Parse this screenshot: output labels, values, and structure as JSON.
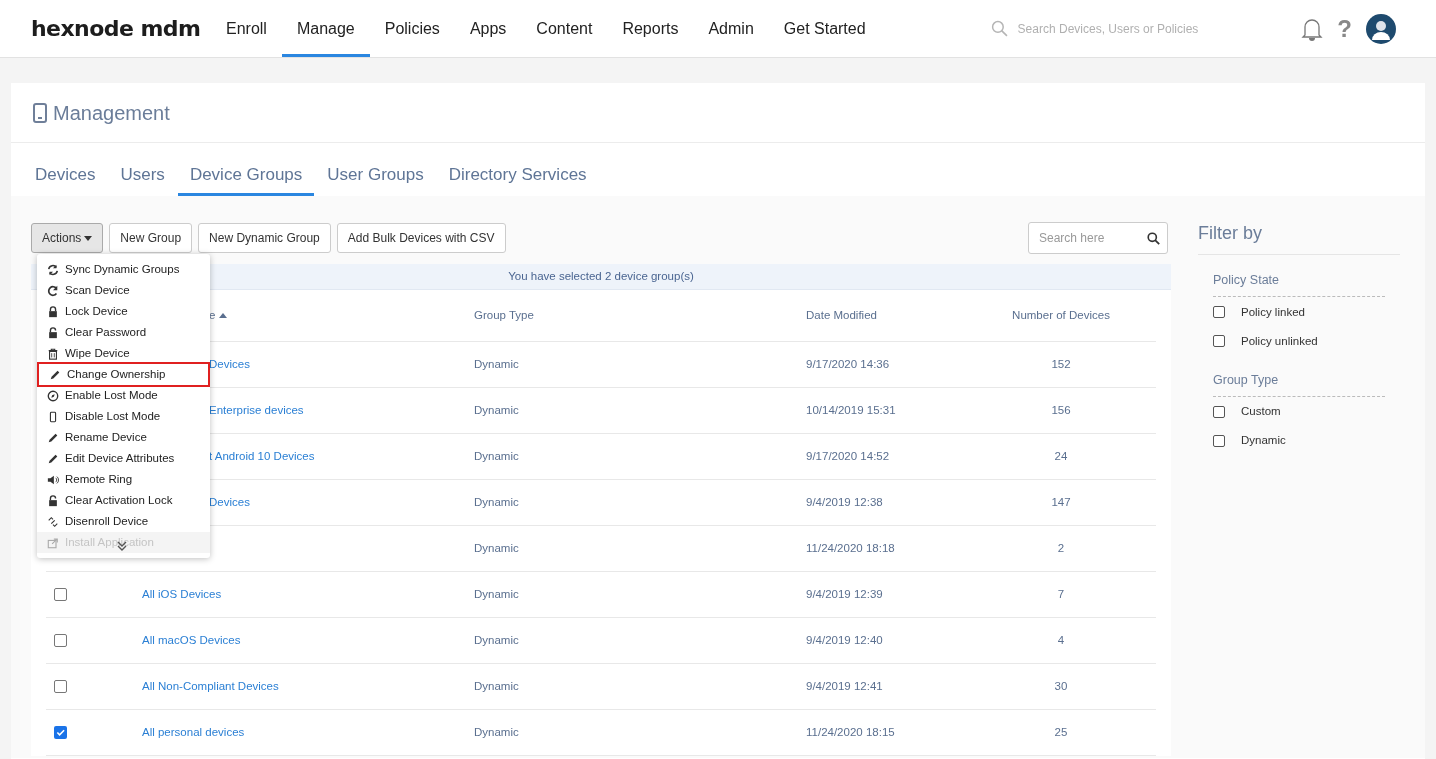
{
  "brand": "hexnode mdm",
  "nav": [
    {
      "label": "Enroll",
      "selected": false
    },
    {
      "label": "Manage",
      "selected": true
    },
    {
      "label": "Policies",
      "selected": false
    },
    {
      "label": "Apps",
      "selected": false
    },
    {
      "label": "Content",
      "selected": false
    },
    {
      "label": "Reports",
      "selected": false
    },
    {
      "label": "Admin",
      "selected": false
    },
    {
      "label": "Get Started",
      "selected": false
    }
  ],
  "global_search": {
    "placeholder": "Search Devices, Users or Policies"
  },
  "help": "?",
  "page_title": "Management",
  "tabs": [
    {
      "label": "Devices",
      "selected": false
    },
    {
      "label": "Users",
      "selected": false
    },
    {
      "label": "Device Groups",
      "selected": true
    },
    {
      "label": "User Groups",
      "selected": false
    },
    {
      "label": "Directory Services",
      "selected": false
    }
  ],
  "toolbar": {
    "buttons": [
      {
        "label": "Actions",
        "kind": "dropdown",
        "active": true
      },
      {
        "label": "New Group",
        "kind": "plain",
        "active": false
      },
      {
        "label": "New Dynamic Group",
        "kind": "plain",
        "active": false
      },
      {
        "label": "Add Bulk Devices with CSV",
        "kind": "plain",
        "active": false
      }
    ],
    "search": {
      "placeholder": "Search here"
    }
  },
  "actions_menu": [
    {
      "label": "Sync Dynamic Groups",
      "highlighted": false,
      "disabled": false
    },
    {
      "label": "Scan Device",
      "highlighted": false,
      "disabled": false
    },
    {
      "label": "Lock Device",
      "highlighted": false,
      "disabled": false
    },
    {
      "label": "Clear Password",
      "highlighted": false,
      "disabled": false
    },
    {
      "label": "Wipe Device",
      "highlighted": false,
      "disabled": false
    },
    {
      "label": "Change Ownership",
      "highlighted": true,
      "disabled": false
    },
    {
      "label": "Enable Lost Mode",
      "highlighted": false,
      "disabled": false
    },
    {
      "label": "Disable Lost Mode",
      "highlighted": false,
      "disabled": false
    },
    {
      "label": "Rename Device",
      "highlighted": false,
      "disabled": false
    },
    {
      "label": "Edit Device Attributes",
      "highlighted": false,
      "disabled": false
    },
    {
      "label": "Remote Ring",
      "highlighted": false,
      "disabled": false
    },
    {
      "label": "Clear Activation Lock",
      "highlighted": false,
      "disabled": false
    },
    {
      "label": "Disenroll Device",
      "highlighted": false,
      "disabled": false
    },
    {
      "label": "Install Application",
      "highlighted": false,
      "disabled": true
    }
  ],
  "selection_notice": "You have selected 2 device group(s)",
  "table": {
    "columns": [
      "e",
      "Group Type",
      "Date Modified",
      "Number of Devices"
    ],
    "rows": [
      {
        "name": "Devices",
        "group_type": "Dynamic",
        "date_modified": "9/17/2020 14:36",
        "devices": "152"
      },
      {
        "name": "Enterprise devices",
        "group_type": "Dynamic",
        "date_modified": "10/14/2019 15:31",
        "devices": "156"
      },
      {
        "name": "t Android 10 Devices",
        "group_type": "Dynamic",
        "date_modified": "9/17/2020 14:52",
        "devices": "24"
      },
      {
        "name": "Devices",
        "group_type": "Dynamic",
        "date_modified": "9/4/2019 12:38",
        "devices": "147"
      },
      {
        "group_type": "Dynamic",
        "date_modified": "11/24/2020 18:18",
        "devices": "2"
      },
      {
        "name": "All iOS Devices",
        "checked": false,
        "group_type": "Dynamic",
        "date_modified": "9/4/2019 12:39",
        "devices": "7"
      },
      {
        "name": "All macOS Devices",
        "checked": false,
        "group_type": "Dynamic",
        "date_modified": "9/4/2019 12:40",
        "devices": "4"
      },
      {
        "name": "All Non-Compliant Devices",
        "checked": false,
        "group_type": "Dynamic",
        "date_modified": "9/4/2019 12:41",
        "devices": "30"
      },
      {
        "name": "All personal devices",
        "checked": true,
        "group_type": "Dynamic",
        "date_modified": "11/24/2020 18:15",
        "devices": "25"
      }
    ]
  },
  "filter": {
    "title": "Filter by",
    "sections": [
      {
        "title": "Policy State",
        "options": [
          {
            "label": "Policy linked",
            "checked": false
          },
          {
            "label": "Policy unlinked",
            "checked": false
          }
        ]
      },
      {
        "title": "Group Type",
        "options": [
          {
            "label": "Custom",
            "checked": false
          },
          {
            "label": "Dynamic",
            "checked": false
          }
        ]
      }
    ]
  }
}
